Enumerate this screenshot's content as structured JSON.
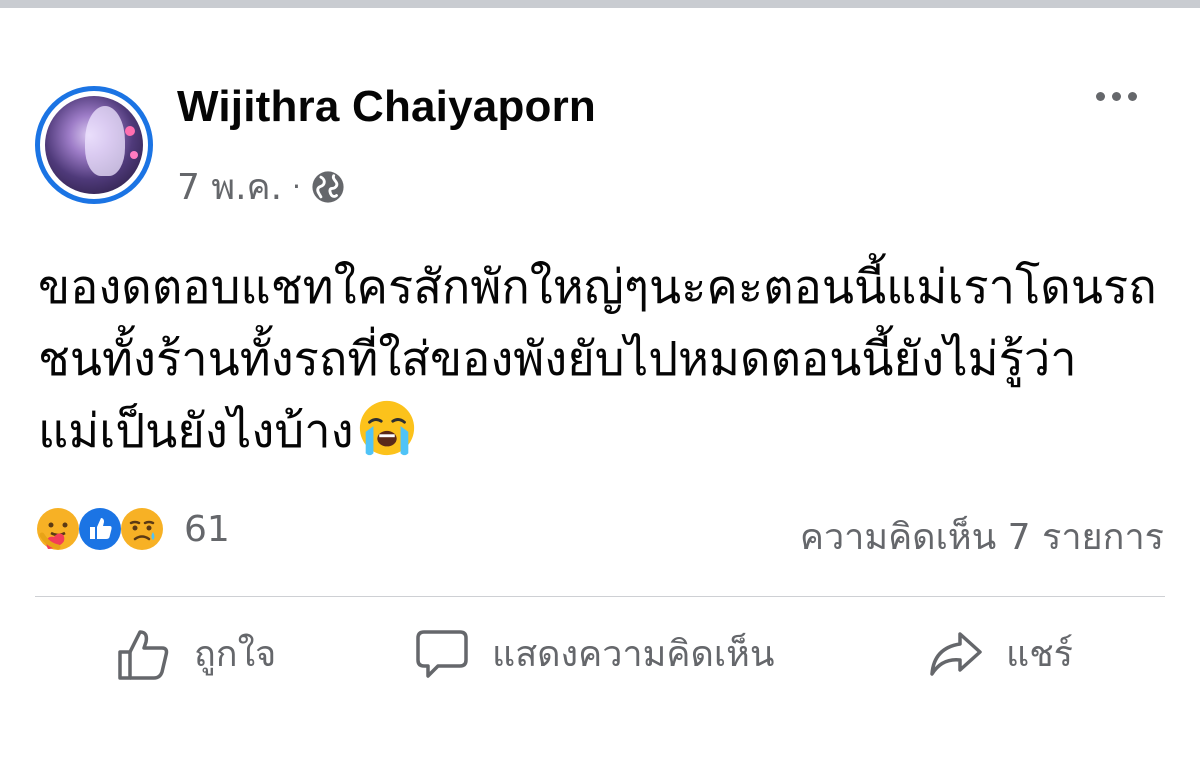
{
  "post": {
    "author": "Wijithra Chaiyaporn",
    "date": "7 พ.ค.",
    "separator": "·",
    "privacy_icon": "globe-icon",
    "text": "ของดตอบแชทใครสักพักใหญ่ๆนะคะตอนนี้แม่เราโดนรถ\nชนทั้งร้านทั้งรถที่ใส่ของพังยับไปหมดตอนนี้ยังไม่รู้ว่า\nแม่เป็นยังไงบ้าง",
    "text_emoji": "loudly-crying-face-emoji",
    "more_icon": "more-options-icon"
  },
  "stats": {
    "reaction_icons": [
      "care-reaction",
      "like-reaction",
      "sad-reaction"
    ],
    "reaction_count": "61",
    "comments_label": "ความคิดเห็น 7 รายการ"
  },
  "actions": {
    "like_label": "ถูกใจ",
    "comment_label": "แสดงความคิดเห็น",
    "share_label": "แชร์"
  },
  "colors": {
    "accent_blue": "#1b74e4",
    "secondary_text": "#65676b",
    "divider": "#ced0d4",
    "reaction_yellow": "#f7b125"
  }
}
